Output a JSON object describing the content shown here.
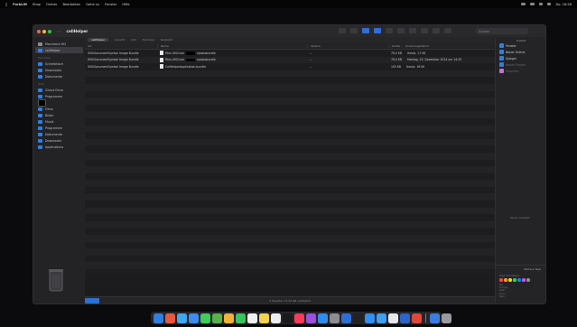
{
  "menubar": {
    "apple_icon": "apple-logo-icon",
    "items": [
      "ForkLift",
      "Shop",
      "Ordner",
      "Bearbeiten",
      "Gehe zu",
      "Fenster",
      "Hilfe"
    ],
    "status": [
      "Do. 16:58"
    ]
  },
  "window": {
    "title": "cellHelper",
    "search_placeholder": "Suchen"
  },
  "sidebar": {
    "sections": [
      {
        "title": "",
        "items": [
          {
            "label": "Macintosh HD",
            "icon": "disk-icon",
            "selected": false
          },
          {
            "label": "cellHelper",
            "icon": "folder-icon",
            "selected": true
          }
        ]
      },
      {
        "title": "Favoriten",
        "items": [
          {
            "label": "Schreibtisch",
            "icon": "desktop-icon",
            "selected": false
          },
          {
            "label": "Downloads",
            "icon": "download-icon",
            "selected": false
          },
          {
            "label": "Dokumente",
            "icon": "folder-icon",
            "selected": false
          }
        ]
      },
      {
        "title": "Orte",
        "items": [
          {
            "label": "iCloud Drive",
            "icon": "cloud-icon",
            "selected": false
          },
          {
            "label": "Programme",
            "icon": "apps-icon",
            "selected": false
          },
          {
            "label": "",
            "icon": "black-square-icon",
            "selected": false
          },
          {
            "label": "Filme",
            "icon": "movie-icon",
            "selected": false
          },
          {
            "label": "Bilder",
            "icon": "picture-icon",
            "selected": false
          },
          {
            "label": "Musik",
            "icon": "music-icon",
            "selected": false
          },
          {
            "label": "Programme",
            "icon": "apps-icon",
            "selected": false
          },
          {
            "label": "Dokumente",
            "icon": "folder-icon",
            "selected": false
          },
          {
            "label": "Downloads",
            "icon": "download-icon",
            "selected": false
          },
          {
            "label": "Applications",
            "icon": "apps-icon",
            "selected": false
          }
        ]
      }
    ]
  },
  "tabs": [
    "cellHelper",
    "Ansicht",
    "Info",
    "Terminal",
    "Vergleich"
  ],
  "columns": [
    "Art",
    "Name",
    "Version",
    "Größe",
    "Änderungsdatum"
  ],
  "rows": [
    {
      "kind": "XMLDocumentSymbol Image Bundle",
      "name_prefix": "Files.UISCrsm",
      "name_suffix": "epasiabundle",
      "version": "--",
      "size": "76,0 KB",
      "date": "Heute, 17:36"
    },
    {
      "kind": "XMLDocumentSymbol Image Bundle",
      "name_prefix": "Files.UISCrsm",
      "name_suffix": "epasiabundle",
      "version": "--",
      "size": "76,0 KB",
      "date": "Montag, 23. Dezember 2024 um 14:29"
    },
    {
      "kind": "XMLDocumentSymbol Image Bundle",
      "name_prefix": "CellHelperApplication.bundle",
      "name_suffix": "",
      "version": "--",
      "size": "105 KB",
      "date": "Heute, 16:56"
    }
  ],
  "statusbar": "3 Objekte, 17,34 GB verfügbar",
  "inspector": {
    "header": "Zuletzt",
    "items": [
      {
        "label": "Fenster",
        "icon": "folder-icon",
        "dim": false
      },
      {
        "label": "Neuer Ordner",
        "icon": "folder-icon",
        "dim": false
      },
      {
        "label": "Spiegel",
        "icon": "folder-icon",
        "dim": false
      },
      {
        "label": "Neues Projekt",
        "icon": "folder-icon",
        "dim": true
      },
      {
        "label": "Favoriten",
        "icon": "tag-icon",
        "dim": true
      }
    ],
    "no_selection": "Keine Auswahl",
    "bottom_header": "Weitere Tags",
    "tags_title": "Tags hinzufügen",
    "tag_colors": [
      "#ff453a",
      "#ff9f0a",
      "#ffd60a",
      "#32d74b",
      "#0a84ff",
      "#bf5af2",
      "#8e8e93"
    ],
    "tag_list": [
      "Rot",
      "Orange",
      "Gelb",
      "Grün",
      "Blau"
    ]
  },
  "dock": {
    "icons": [
      {
        "name": "finder-icon",
        "color": "#2f7fe0"
      },
      {
        "name": "launchpad-icon",
        "color": "#e7593b"
      },
      {
        "name": "safari-icon",
        "color": "#3fa7f2"
      },
      {
        "name": "mail-icon",
        "color": "#3b8df0"
      },
      {
        "name": "messages-icon",
        "color": "#3ecf5a"
      },
      {
        "name": "maps-icon",
        "color": "#5ab04a"
      },
      {
        "name": "photos-icon",
        "color": "#f2b13b"
      },
      {
        "name": "facetime-icon",
        "color": "#37c45a"
      },
      {
        "name": "calendar-icon",
        "color": "#f0f0f0"
      },
      {
        "name": "notes-icon",
        "color": "#f4d34a"
      },
      {
        "name": "reminders-icon",
        "color": "#ededed"
      },
      {
        "name": "tv-icon",
        "color": "#1a1a1a"
      },
      {
        "name": "music-icon",
        "color": "#fa3b56"
      },
      {
        "name": "podcasts-icon",
        "color": "#9b4fe0"
      },
      {
        "name": "appstore-icon",
        "color": "#2d8cf0"
      },
      {
        "name": "settings-icon",
        "color": "#8c8c92"
      },
      {
        "name": "forklift-icon",
        "color": "#2c6fd8"
      },
      {
        "name": "terminal-icon",
        "color": "#222"
      },
      {
        "name": "xcode-icon",
        "color": "#2e8ff5"
      },
      {
        "name": "preview-icon",
        "color": "#3f9ef0"
      },
      {
        "name": "textedit-icon",
        "color": "#e8e8e8"
      },
      {
        "name": "word-icon",
        "color": "#2b63c8"
      },
      {
        "name": "chrome-icon",
        "color": "#e1463a"
      }
    ],
    "after_sep": [
      {
        "name": "downloads-stack-icon",
        "color": "#3a7de0"
      },
      {
        "name": "trash-icon",
        "color": "#9a9aa0"
      }
    ]
  }
}
